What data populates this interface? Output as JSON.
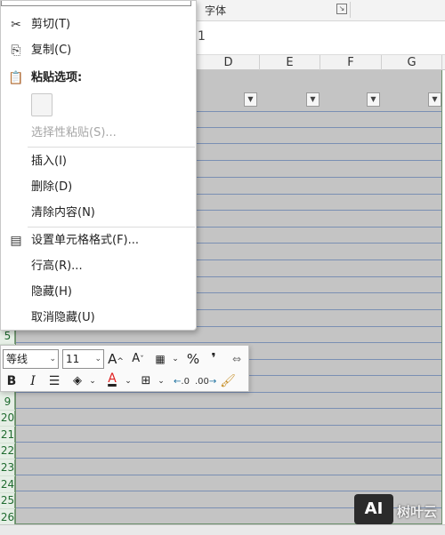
{
  "ribbon": {
    "font_group_label": "字体"
  },
  "formula_bar": {
    "value": "1"
  },
  "columns": [
    "D",
    "E",
    "F",
    "G"
  ],
  "rows": [
    "5",
    "9",
    "20",
    "21",
    "22",
    "23",
    "24",
    "25",
    "26"
  ],
  "context_menu": {
    "items": [
      {
        "label": "剪切(T)",
        "icon": "scissors-icon",
        "disabled": false
      },
      {
        "label": "复制(C)",
        "icon": "copy-icon",
        "disabled": false
      },
      {
        "label": "粘贴选项:",
        "icon": "clipboard-icon",
        "disabled": false
      },
      {
        "label": "选择性粘贴(S)...",
        "icon": "",
        "disabled": true
      },
      {
        "label": "插入(I)",
        "icon": "",
        "disabled": false
      },
      {
        "label": "删除(D)",
        "icon": "",
        "disabled": false
      },
      {
        "label": "清除内容(N)",
        "icon": "",
        "disabled": false
      },
      {
        "label": "设置单元格格式(F)...",
        "icon": "format-cells-icon",
        "disabled": false
      },
      {
        "label": "行高(R)...",
        "icon": "",
        "disabled": false
      },
      {
        "label": "隐藏(H)",
        "icon": "",
        "disabled": false
      },
      {
        "label": "取消隐藏(U)",
        "icon": "",
        "disabled": false
      }
    ]
  },
  "mini_toolbar": {
    "font_name": "等线",
    "font_size": "11",
    "percent": "%",
    "comma": "❜",
    "bold": "B",
    "italic": "I",
    "font_color_letter": "A",
    "decrease_decimal": ".00",
    "increase_decimal": ".0",
    "font_color_accent": "#e02020"
  },
  "watermark": {
    "logo_text": "AI",
    "text": "树叶云"
  }
}
